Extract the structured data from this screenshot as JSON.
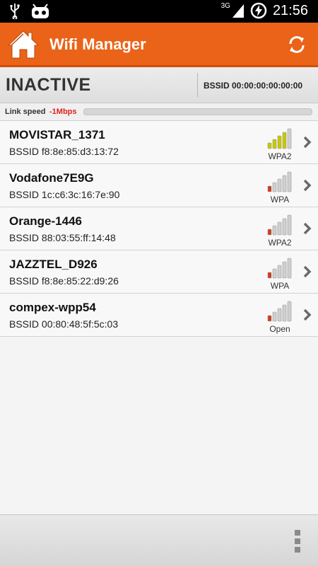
{
  "statusbar": {
    "time": "21:56",
    "network_type": "3G",
    "icons": [
      "usb-icon",
      "android-debug-icon",
      "signal-icon",
      "battery-charging-icon"
    ]
  },
  "actionbar": {
    "title": "Wifi Manager",
    "icons": [
      "home-icon",
      "refresh-icon"
    ],
    "color": "#ea6318"
  },
  "status": {
    "state": "INACTIVE",
    "bssid": "BSSID 00:00:00:00:00:00"
  },
  "link_speed": {
    "label": "Link speed",
    "value": "-1Mbps"
  },
  "networks": [
    {
      "ssid": "MOVISTAR_1371",
      "bssid": "BSSID f8:8e:85:d3:13:72",
      "security": "WPA2",
      "bars": 4,
      "color": "#c8c800"
    },
    {
      "ssid": "Vodafone7E9G",
      "bssid": "BSSID 1c:c6:3c:16:7e:90",
      "security": "WPA",
      "bars": 1,
      "color": "#d23a1c"
    },
    {
      "ssid": "Orange-1446",
      "bssid": "BSSID 88:03:55:ff:14:48",
      "security": "WPA2",
      "bars": 1,
      "color": "#d23a1c"
    },
    {
      "ssid": "JAZZTEL_D926",
      "bssid": "BSSID f8:8e:85:22:d9:26",
      "security": "WPA",
      "bars": 1,
      "color": "#d23a1c"
    },
    {
      "ssid": "compex-wpp54",
      "bssid": "BSSID 00:80:48:5f:5c:03",
      "security": "Open",
      "bars": 1,
      "color": "#d23a1c"
    }
  ]
}
